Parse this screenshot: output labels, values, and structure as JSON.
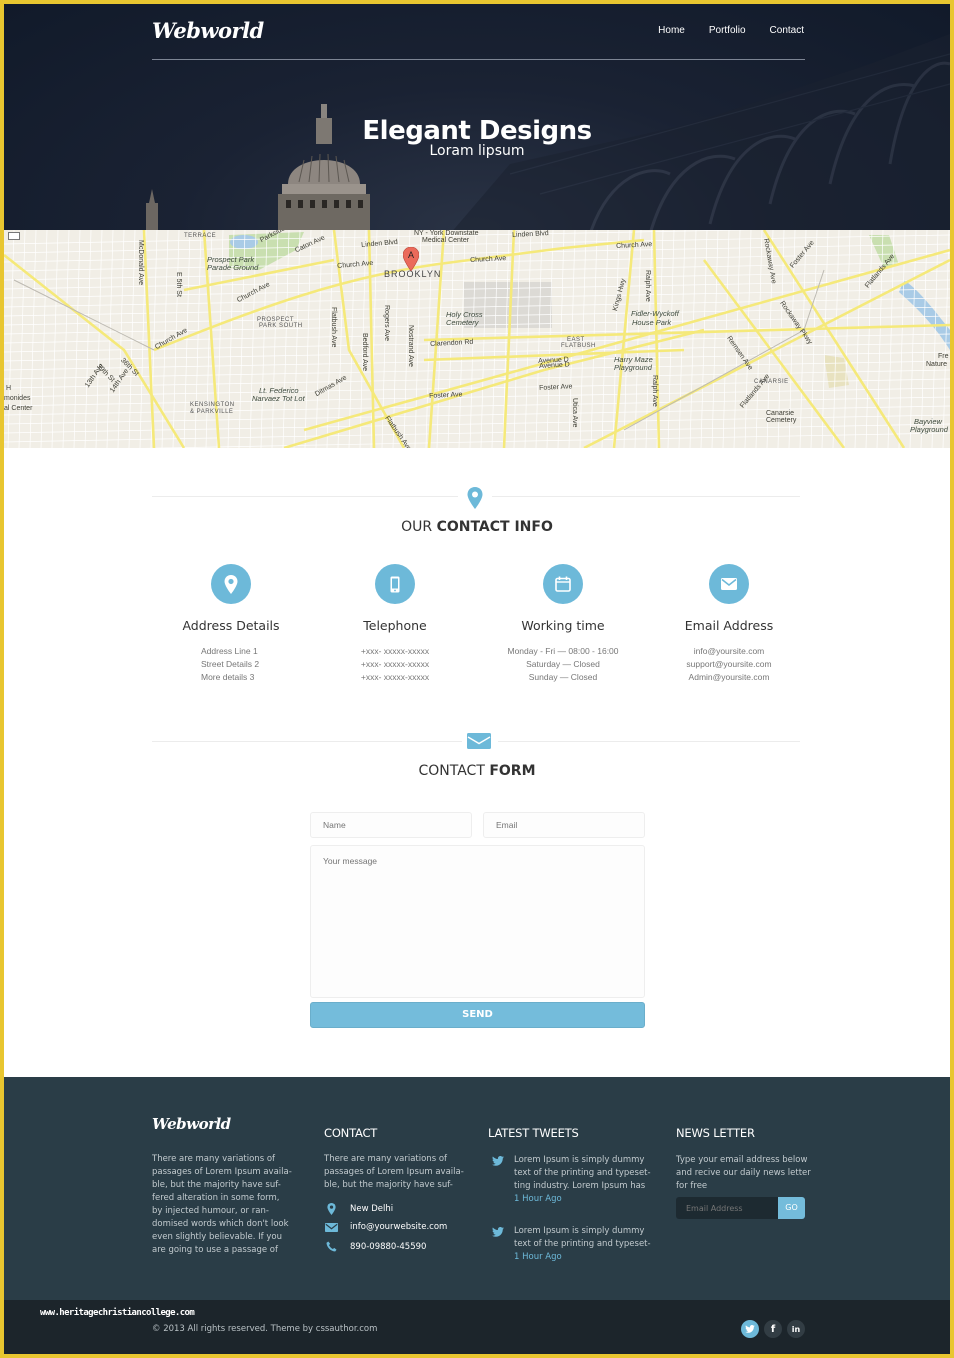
{
  "header": {
    "logo": "Webworld",
    "nav": [
      {
        "label": "Home"
      },
      {
        "label": "Portfolio"
      },
      {
        "label": "Contact"
      }
    ]
  },
  "hero": {
    "title": "Elegant Designs",
    "subtitle": "Loram lipsum"
  },
  "map": {
    "marker_label": "A",
    "labels": [
      {
        "text": "TERRACE",
        "style": "caps"
      },
      {
        "text": "Prospect Park",
        "style": "it"
      },
      {
        "text": "Parade Ground",
        "style": "it"
      },
      {
        "text": "Parkside Ave",
        "style": ""
      },
      {
        "text": "Caton Ave",
        "style": ""
      },
      {
        "text": "Linden Blvd",
        "style": ""
      },
      {
        "text": "NY - York Downstate",
        "style": ""
      },
      {
        "text": "Medical Center",
        "style": ""
      },
      {
        "text": "Church Ave",
        "style": ""
      },
      {
        "text": "BROOKLYN",
        "style": "big"
      },
      {
        "text": "Church Ave",
        "style": ""
      },
      {
        "text": "Linden Blvd",
        "style": ""
      },
      {
        "text": "Church Ave",
        "style": ""
      },
      {
        "text": "McDonald Ave",
        "style": ""
      },
      {
        "text": "E 5th St",
        "style": ""
      },
      {
        "text": "Church Ave",
        "style": ""
      },
      {
        "text": "PROSPECT",
        "style": "caps"
      },
      {
        "text": "PARK SOUTH",
        "style": "caps"
      },
      {
        "text": "Holy Cross",
        "style": "it"
      },
      {
        "text": "Cemetery",
        "style": "it"
      },
      {
        "text": "Flatbush Ave",
        "style": ""
      },
      {
        "text": "Bedford Ave",
        "style": ""
      },
      {
        "text": "Rogers Ave",
        "style": ""
      },
      {
        "text": "Nostrand Ave",
        "style": ""
      },
      {
        "text": "Clarendon Rd",
        "style": ""
      },
      {
        "text": "Church Ave",
        "style": ""
      },
      {
        "text": "36th St",
        "style": ""
      },
      {
        "text": "39th St",
        "style": ""
      },
      {
        "text": "13th Ave",
        "style": ""
      },
      {
        "text": "14th Ave",
        "style": ""
      },
      {
        "text": "Avenue D",
        "style": ""
      },
      {
        "text": "Lt. Federico",
        "style": "it"
      },
      {
        "text": "Narvaez Tot Lot",
        "style": "it"
      },
      {
        "text": "Ditmas Ave",
        "style": ""
      },
      {
        "text": "Foster Ave",
        "style": ""
      },
      {
        "text": "KENSINGTON",
        "style": "caps"
      },
      {
        "text": "& PARKVILLE",
        "style": "caps"
      },
      {
        "text": "Flatbush Ave",
        "style": ""
      },
      {
        "text": "Kings Hwy",
        "style": ""
      },
      {
        "text": "Fidler-Wyckoff",
        "style": "it"
      },
      {
        "text": "House Park",
        "style": "it"
      },
      {
        "text": "EAST",
        "style": "caps"
      },
      {
        "text": "FLATBUSH",
        "style": "caps"
      },
      {
        "text": "Avenue D",
        "style": ""
      },
      {
        "text": "Harry Maze",
        "style": "it"
      },
      {
        "text": "Playground",
        "style": "it"
      },
      {
        "text": "Foster Ave",
        "style": ""
      },
      {
        "text": "Utica Ave",
        "style": ""
      },
      {
        "text": "Ralph Ave",
        "style": ""
      },
      {
        "text": "Ralph Ave",
        "style": ""
      },
      {
        "text": "Rockaway Ave",
        "style": ""
      },
      {
        "text": "Foster Ave",
        "style": ""
      },
      {
        "text": "Rockaway Pkwy",
        "style": ""
      },
      {
        "text": "Remsen Ave",
        "style": ""
      },
      {
        "text": "Flatlands Ave",
        "style": ""
      },
      {
        "text": "CANARSIE",
        "style": "caps"
      },
      {
        "text": "Flatlands Ave",
        "style": ""
      },
      {
        "text": "Canarsie",
        "style": ""
      },
      {
        "text": "Cemetery",
        "style": ""
      },
      {
        "text": "Bayview",
        "style": "it"
      },
      {
        "text": "Playground",
        "style": "it"
      },
      {
        "text": "Fre",
        "style": ""
      },
      {
        "text": "Nature",
        "style": ""
      },
      {
        "text": "H",
        "style": ""
      },
      {
        "text": "monides",
        "style": ""
      },
      {
        "text": "al Center",
        "style": ""
      }
    ]
  },
  "contact_info": {
    "title_light": "OUR ",
    "title_bold": "CONTACT INFO",
    "columns": [
      {
        "icon": "location-pin-icon",
        "heading": "Address Details",
        "lines": [
          "Address Line 1",
          "Street Details 2",
          "More details 3"
        ]
      },
      {
        "icon": "mobile-phone-icon",
        "heading": "Telephone",
        "lines": [
          "+xxx- xxxxx-xxxxx",
          "+xxx- xxxxx-xxxxx",
          "+xxx- xxxxx-xxxxx"
        ]
      },
      {
        "icon": "calendar-icon",
        "heading": "Working time",
        "lines": [
          "Monday - Fri — 08:00 - 16:00",
          "Saturday — Closed",
          "Sunday — Closed"
        ]
      },
      {
        "icon": "envelope-icon",
        "heading": "Email Address",
        "lines": [
          "info@yoursite.com",
          "support@yoursite.com",
          "Admin@yoursite.com"
        ]
      }
    ]
  },
  "contact_form": {
    "title_light": "CONTACT ",
    "title_bold": "FORM",
    "name_placeholder": "Name",
    "email_placeholder": "Email",
    "message_placeholder": "Your message",
    "send_label": "SEND"
  },
  "footer": {
    "logo": "Webworld",
    "about_text": [
      "There are many variations of",
      "passages of Lorem Ipsum availa-",
      "ble, but the majority have suf-",
      "fered alteration in some form,",
      "by injected humour, or ran-",
      "domised words which don't look",
      "even slightly believable. If you",
      "are going to use a passage of"
    ],
    "contact": {
      "title": "CONTACT",
      "text": [
        "There are many variations of",
        "passages of Lorem Ipsum availa-",
        "ble, but the majority have suf-"
      ],
      "location": "New Delhi",
      "email": "info@yourwebsite.com",
      "phone": "890-09880-45590"
    },
    "tweets": {
      "title": "LATEST TWEETS",
      "items": [
        {
          "lines": [
            "Lorem Ipsum is simply dummy",
            "text of the printing and typeset-",
            "ting industry. Lorem Ipsum has"
          ],
          "time": "1 Hour Ago"
        },
        {
          "lines": [
            "Lorem Ipsum is simply dummy",
            "text of the printing and typeset-"
          ],
          "time": "1 Hour Ago"
        }
      ]
    },
    "newsletter": {
      "title": "NEWS LETTER",
      "text": [
        "Type your email address below",
        "and recive our daily news letter",
        "for free"
      ],
      "placeholder": "Email Address",
      "go_label": "GO"
    }
  },
  "bottom_bar": {
    "watermark": "www.heritagechristiancollege.com",
    "copyright": "© 2013 All rights reserved.  Theme by cssauthor.com",
    "social": [
      {
        "name": "twitter",
        "glyph": "t"
      },
      {
        "name": "facebook",
        "glyph": "f"
      },
      {
        "name": "linkedin",
        "glyph": "in"
      }
    ]
  },
  "colors": {
    "accent": "#6db9d9",
    "hero_bg": "#111a2a",
    "footer_bg": "#2a3d47",
    "bottom_bg": "#1c252b",
    "frame": "#e8c630",
    "map_road": "#f5e97a",
    "map_bg": "#f1eee6"
  }
}
